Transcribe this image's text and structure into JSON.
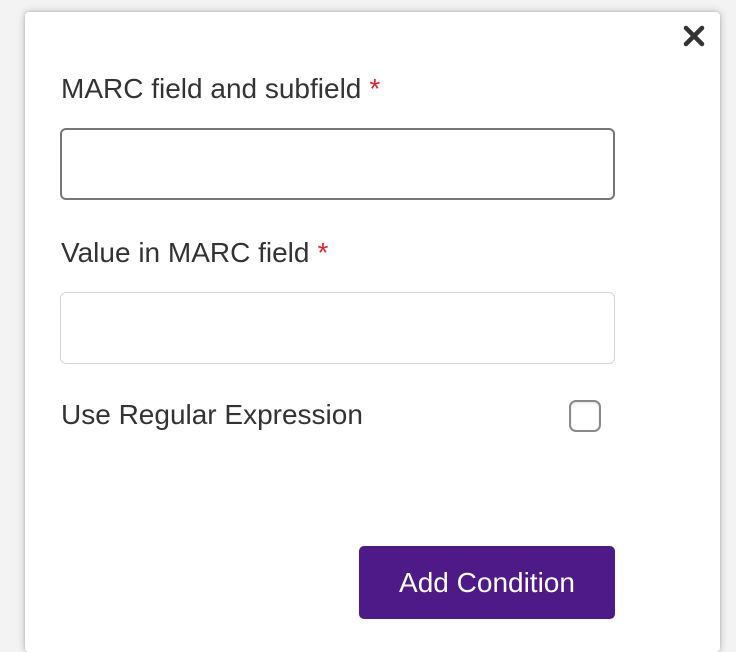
{
  "dialog": {
    "close_icon": "close-icon",
    "marc_field": {
      "label": "MARC field and subfield",
      "required_marker": "*",
      "value": "",
      "placeholder": ""
    },
    "marc_value": {
      "label": "Value in MARC field",
      "required_marker": "*",
      "value": "",
      "placeholder": ""
    },
    "regex": {
      "label": "Use Regular Expression",
      "checked": false
    },
    "submit_label": "Add Condition"
  },
  "colors": {
    "accent": "#4e1a87",
    "required": "#e0242a",
    "text": "#333333"
  }
}
